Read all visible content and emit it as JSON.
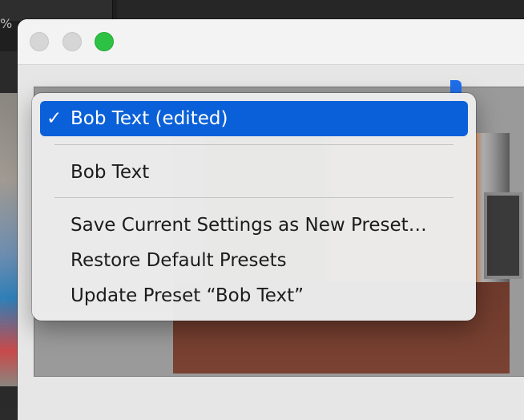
{
  "background_app": {
    "zoom_fragment": "%"
  },
  "window": {
    "traffic_lights": [
      "close",
      "minimize",
      "zoom"
    ]
  },
  "preset_menu": {
    "items": [
      {
        "label": "Bob Text (edited)",
        "checked": true,
        "selected": true
      },
      {
        "label": "Bob Text"
      },
      {
        "label": "Save Current Settings as New Preset…"
      },
      {
        "label": "Restore Default Presets"
      },
      {
        "label": "Update Preset “Bob Text”"
      }
    ],
    "check_glyph": "✓",
    "highlight_color": "#0a60d8"
  }
}
